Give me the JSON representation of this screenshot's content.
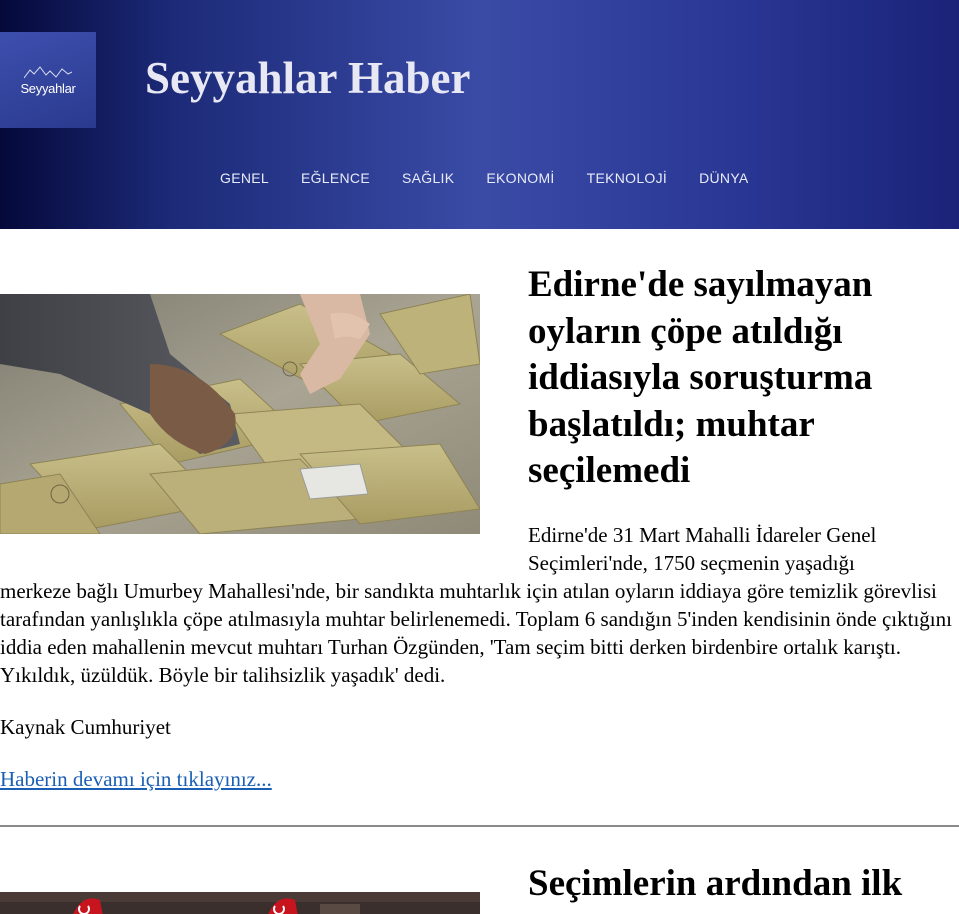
{
  "header": {
    "logo_text": "Seyyahlar",
    "site_title": "Seyyahlar Haber",
    "nav": [
      "GENEL",
      "EĞLENCE",
      "SAĞLIK",
      "EKONOMİ",
      "TEKNOLOJİ",
      "DÜNYA"
    ],
    "colors": {
      "header_dark": "#05093a",
      "header_mid": "#3a4ba6",
      "logo_bg": "#3d4fae"
    }
  },
  "articles": [
    {
      "title": "Edirne'de sayılmayan oyların çöpe atıldığı iddiasıyla soruşturma başlatıldı; muhtar seçilemedi",
      "image": "ballot-envelopes-photo",
      "body_line1": "Edirne'de 31 Mart Mahalli İdareler Genel",
      "body_line2": "Seçimleri'nde, 1750 seçmenin yaşadığı",
      "body_rest": "merkeze bağlı Umurbey Mahallesi'nde, bir sandıkta muhtarlık için atılan oyların iddiaya göre temizlik görevlisi tarafından yanlışlıkla çöpe atılmasıyla muhtar belirlenemedi. Toplam 6 sandığın 5'inden kendisinin önde çıktığını iddia eden mahallenin mevcut muhtarı Turhan Özgünden, 'Tam seçim bitti derken birdenbire ortalık karıştı. Yıkıldık, üzüldük. Böyle bir talihsizlik yaşadık' dedi.",
      "source": "Kaynak Cumhuriyet",
      "read_more": "Haberin devamı için tıklayınız..."
    },
    {
      "title": "Seçimlerin ardından ilk",
      "image": "flags-photo"
    }
  ],
  "link_color": "#1a5fb4"
}
